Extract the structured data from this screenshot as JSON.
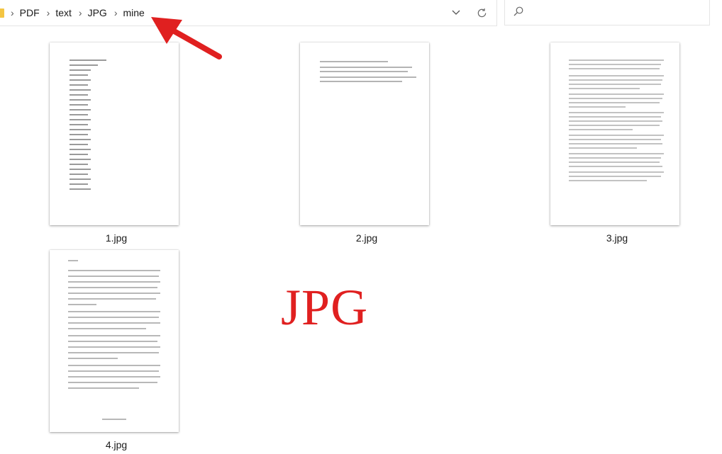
{
  "address_bar": {
    "path": [
      "PDF",
      "text",
      "JPG",
      "mine"
    ],
    "separator": "›",
    "dropdown_icon": "chevron-down-icon",
    "refresh_icon": "refresh-icon"
  },
  "search": {
    "placeholder": "",
    "icon": "search-icon"
  },
  "files": [
    {
      "name": "1.jpg"
    },
    {
      "name": "2.jpg"
    },
    {
      "name": "3.jpg"
    },
    {
      "name": "4.jpg"
    }
  ],
  "watermark": {
    "text": "JPG",
    "color": "#e02020"
  },
  "colors": {
    "arrow": "#e02020",
    "folder": "#f4c542"
  }
}
